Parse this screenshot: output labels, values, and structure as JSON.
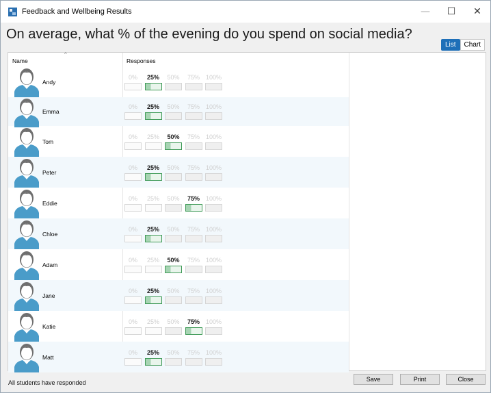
{
  "window": {
    "title": "Feedback and Wellbeing Results",
    "app_icon": "app-logo-icon",
    "controls": {
      "minimize": "—",
      "maximize": "☐",
      "close": "✕"
    }
  },
  "question": "On average, what % of the evening do you spend on social media?",
  "view_toggle": {
    "list_label": "List",
    "chart_label": "Chart",
    "active": "List",
    "accent": "#1e6fb8"
  },
  "table": {
    "header_name": "Name",
    "header_responses": "Responses",
    "options": [
      "0%",
      "25%",
      "50%",
      "75%",
      "100%"
    ],
    "selected_color": "#3f9a57",
    "alt_row_color": "#f2f8fc",
    "rows": [
      {
        "name": "Andy",
        "response": "25%"
      },
      {
        "name": "Emma",
        "response": "25%"
      },
      {
        "name": "Tom",
        "response": "50%"
      },
      {
        "name": "Peter",
        "response": "25%"
      },
      {
        "name": "Eddie",
        "response": "75%"
      },
      {
        "name": "Chloe",
        "response": "25%"
      },
      {
        "name": "Adam",
        "response": "50%"
      },
      {
        "name": "Jane",
        "response": "25%"
      },
      {
        "name": "Katie",
        "response": "75%"
      },
      {
        "name": "Matt",
        "response": "25%"
      }
    ]
  },
  "status": "All students have responded",
  "buttons": {
    "save": "Save",
    "print": "Print",
    "close": "Close"
  }
}
